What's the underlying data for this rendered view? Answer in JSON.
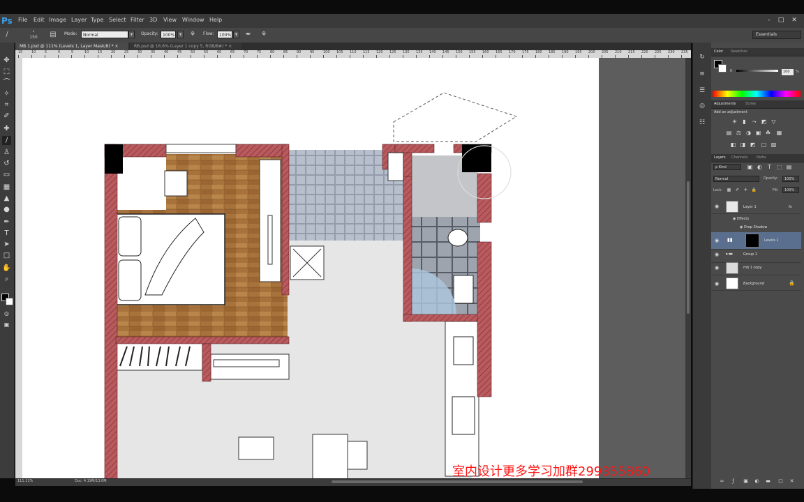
{
  "app": {
    "logo": "Ps",
    "menu": [
      "File",
      "Edit",
      "Image",
      "Layer",
      "Type",
      "Select",
      "Filter",
      "3D",
      "View",
      "Window",
      "Help"
    ],
    "window_buttons": [
      "-",
      "□",
      "✕"
    ]
  },
  "options_bar": {
    "brush_size": "150",
    "mode_label": "Mode:",
    "mode_value": "Normal",
    "opacity_label": "Opacity:",
    "opacity_value": "100%",
    "flow_label": "Flow:",
    "flow_value": "100%",
    "workspace": "Essentials"
  },
  "tabs": [
    {
      "label": "MB 1.psd @ 111% (Levels 1, Layer Mask/8) *",
      "close": "×"
    },
    {
      "label": "RB.psd @ 16.6% (Layer 1 copy 5, RGB/8#) *",
      "close": "×"
    }
  ],
  "ruler_numbers": [
    "15",
    "10",
    "5",
    "0",
    "5",
    "10",
    "15",
    "20",
    "25",
    "30",
    "35",
    "40",
    "45",
    "50",
    "55",
    "60",
    "65",
    "70",
    "75",
    "80",
    "85",
    "90",
    "95",
    "100",
    "105",
    "110",
    "115",
    "120",
    "125",
    "130",
    "135",
    "140",
    "145",
    "150",
    "155",
    "160",
    "165",
    "170",
    "175",
    "180",
    "185",
    "190",
    "195",
    "200",
    "205",
    "210",
    "215",
    "220",
    "225",
    "230",
    "235"
  ],
  "status": {
    "zoom": "111.11%",
    "doc": "Doc: 4.19M/13.0M"
  },
  "panels": {
    "color_tabs": [
      "Color",
      "Swatches"
    ],
    "color_k_label": "K",
    "color_k_value": "100",
    "color_k_unit": "%",
    "adjust_tabs": [
      "Adjustments",
      "Styles"
    ],
    "adjust_title": "Add an adjustment",
    "layers_tabs": [
      "Layers",
      "Channels",
      "Paths"
    ],
    "kind_label": "ρ Kind",
    "blend_mode": "Normal",
    "opacity_label": "Opacity:",
    "opacity_value": "100%",
    "lock_label": "Lock:",
    "fill_label": "Fill:",
    "fill_value": "100%",
    "layers": [
      {
        "name": "Layer 1",
        "fx": "fx"
      },
      {
        "name": "Effects"
      },
      {
        "name": "Drop Shadow"
      },
      {
        "name": "Levels 1"
      },
      {
        "name": "Group 1"
      },
      {
        "name": "mb 1 copy"
      },
      {
        "name": "Background"
      }
    ]
  },
  "watermark": "室内设计更多学习加群299355860",
  "colors": {
    "wall": "#b85a5e",
    "wood": "#a8723c",
    "tile": "#b7bfcc",
    "floor": "#e6e6e6"
  }
}
